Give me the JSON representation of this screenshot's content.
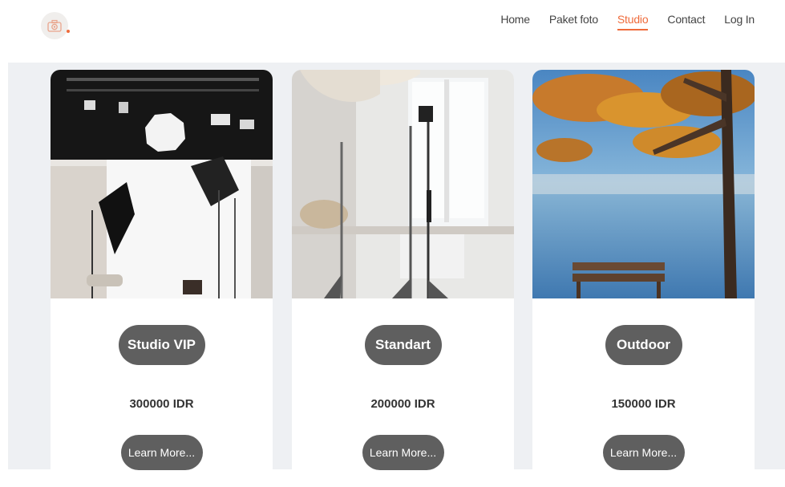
{
  "nav": {
    "logo_icon": "camera-icon",
    "links": [
      {
        "label": "Home"
      },
      {
        "label": "Paket foto"
      },
      {
        "label": "Studio"
      },
      {
        "label": "Contact"
      },
      {
        "label": "Log In"
      }
    ],
    "active": "Studio",
    "accent_color": "#ef6b3b"
  },
  "cards": [
    {
      "title": "Studio VIP",
      "price": "300000 IDR",
      "button": "Learn More...",
      "image": "photo-studio-lights-image"
    },
    {
      "title": "Standart",
      "price": "200000 IDR",
      "button": "Learn More...",
      "image": "studio-window-stands-image"
    },
    {
      "title": "Outdoor",
      "price": "150000 IDR",
      "button": "Learn More...",
      "image": "autumn-lake-bench-image"
    }
  ]
}
